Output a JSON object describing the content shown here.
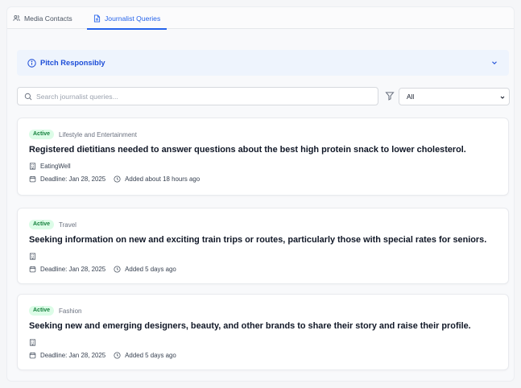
{
  "tabs": [
    {
      "label": "Media Contacts",
      "active": false,
      "icon": "users-icon"
    },
    {
      "label": "Journalist Queries",
      "active": true,
      "icon": "document-icon"
    }
  ],
  "pitch_banner": {
    "title": "Pitch Responsibly",
    "icon": "info-icon",
    "expand_icon": "chevron-down-icon"
  },
  "search": {
    "placeholder": "Search journalist queries...",
    "value": ""
  },
  "filter": {
    "icon": "filter-icon",
    "selected": "All"
  },
  "queries": [
    {
      "status": "Active",
      "category": "Lifestyle and Entertainment",
      "title": "Registered dietitians needed to answer questions about the best high protein snack to lower cholesterol.",
      "outlet": "EatingWell",
      "deadline": "Deadline: Jan 28, 2025",
      "added": "Added about 18 hours ago"
    },
    {
      "status": "Active",
      "category": "Travel",
      "title": "Seeking information on new and exciting train trips or routes, particularly those with special rates for seniors.",
      "outlet": "",
      "deadline": "Deadline: Jan 28, 2025",
      "added": "Added 5 days ago"
    },
    {
      "status": "Active",
      "category": "Fashion",
      "title": "Seeking new and emerging designers, beauty, and other brands to share their story and raise their profile.",
      "outlet": "",
      "deadline": "Deadline: Jan 28, 2025",
      "added": "Added 5 days ago"
    }
  ],
  "colors": {
    "accent": "#2563eb",
    "badge_bg": "#dcfce7",
    "badge_text": "#15803d",
    "banner_bg": "#eef4fd"
  }
}
